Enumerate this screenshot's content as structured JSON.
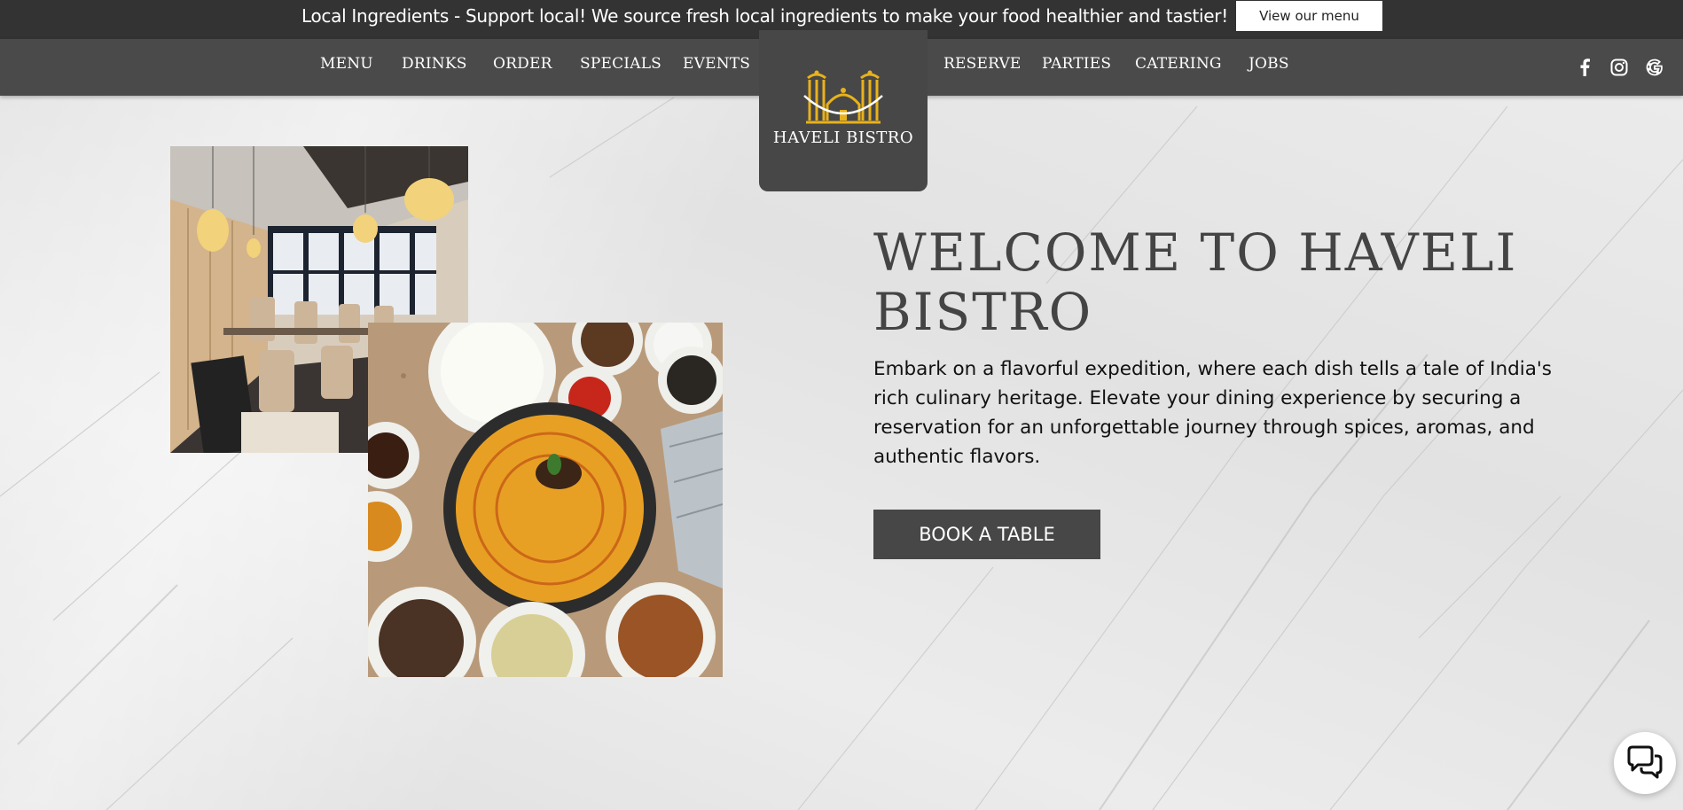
{
  "promo": {
    "text": "Local Ingredients - Support local! We source fresh local ingredients to make your food healthier and tastier!",
    "button_label": "View our menu"
  },
  "nav": {
    "left_items": [
      "MENU",
      "DRINKS",
      "ORDER",
      "SPECIALS",
      "EVENTS"
    ],
    "right_items": [
      "RESERVE",
      "PARTIES",
      "CATERING",
      "JOBS"
    ],
    "social": [
      "facebook-icon",
      "instagram-icon",
      "google-icon"
    ]
  },
  "logo": {
    "text": "HAVELI BISTRO",
    "accent_color": "#e8b21c"
  },
  "hero": {
    "title": "WELCOME TO HAVELI BISTRO",
    "description": "Embark on a flavorful expedition, where each dish tells a tale of India's rich culinary heritage. Elevate your dining experience by securing a reservation for an unforgettable journey through spices, aromas, and authentic flavors.",
    "button_label": "BOOK A TABLE"
  },
  "images": {
    "interior": "restaurant-interior-photo",
    "food": "curry-and-spices-photo"
  },
  "chat": {
    "icon": "chat-bubbles-icon"
  },
  "colors": {
    "bar_dark": "#333333",
    "nav_bg": "#4a4a4a",
    "button_bg": "#474747"
  }
}
